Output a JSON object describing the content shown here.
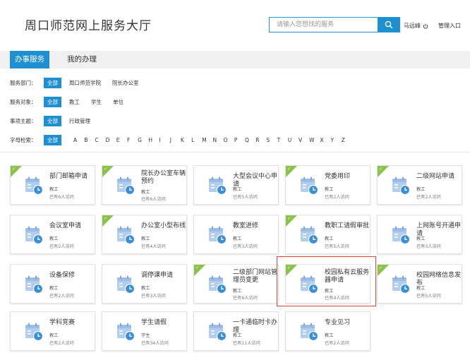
{
  "header": {
    "title": "周口师范网上服务大厅",
    "search_placeholder": "请输入您想找的服务",
    "user_name": "马远峰",
    "admin_label": "管理入口"
  },
  "nav": {
    "tabs": [
      {
        "label": "办事服务",
        "active": true
      },
      {
        "label": "我的办理",
        "active": false
      }
    ]
  },
  "filters": {
    "department": {
      "label": "服务部门：",
      "all": "全部",
      "options": [
        "周口师范学院",
        "院长办公室"
      ]
    },
    "audience": {
      "label": "服务对象：",
      "all": "全部",
      "options": [
        "教工",
        "学生",
        "单位"
      ]
    },
    "topic": {
      "label": "事项主题：",
      "all": "全部",
      "options": [
        "行政管理"
      ]
    },
    "letter": {
      "label": "字母检索：",
      "all": "全部",
      "letters": [
        "A",
        "B",
        "C",
        "D",
        "E",
        "F",
        "G",
        "H",
        "I",
        "J",
        "K",
        "L",
        "M",
        "N",
        "O",
        "P",
        "Q",
        "R",
        "S",
        "T",
        "U",
        "V",
        "W",
        "X",
        "Y",
        "Z"
      ]
    }
  },
  "services": [
    {
      "title": "部门邮箱申请",
      "audience": "教工",
      "visits": "已有6人访问",
      "badge": true
    },
    {
      "title": "院长办公室车辆预约",
      "audience": "教工",
      "visits": "已有6人访问",
      "badge": true
    },
    {
      "title": "大型会议中心申请",
      "audience": "教工",
      "visits": "已有5人访问",
      "badge": false
    },
    {
      "title": "党委用印",
      "audience": "教工",
      "visits": "已有2人访问",
      "badge": true
    },
    {
      "title": "二级网站申请",
      "audience": "教工",
      "visits": "已有2人访问",
      "badge": true
    },
    {
      "title": "会议室申请",
      "audience": "教工",
      "visits": "已有2人访问",
      "badge": false
    },
    {
      "title": "办公室小型布线",
      "audience": "教工",
      "visits": "已有4人访问",
      "badge": true
    },
    {
      "title": "教室进修",
      "audience": "教工",
      "visits": "已有3人访问",
      "badge": false
    },
    {
      "title": "教职工请假审批",
      "audience": "教工",
      "visits": "已有5人访问",
      "badge": true
    },
    {
      "title": "上网账号开通申请",
      "audience": "教工",
      "visits": "已有3人访问",
      "badge": false
    },
    {
      "title": "设备保修",
      "audience": "教工",
      "visits": "已有2人访问",
      "badge": false
    },
    {
      "title": "调停课申请",
      "audience": "教工",
      "visits": "已有3人访问",
      "badge": false
    },
    {
      "title": "二级部门网站管理员变更",
      "audience": "教工",
      "visits": "已有6人访问",
      "badge": true
    },
    {
      "title": "校园私有云服务器申请",
      "audience": "教工",
      "visits": "已有4人访问",
      "badge": true
    },
    {
      "title": "校园网络信息发布",
      "audience": "教工",
      "visits": "已有5人访问",
      "badge": true
    },
    {
      "title": "学科竞赛",
      "audience": "教工",
      "visits": "已有2人访问",
      "badge": false
    },
    {
      "title": "学生请假",
      "audience": "学生",
      "visits": "已有34人访问",
      "badge": false
    },
    {
      "title": "一卡通临时卡办理",
      "audience": "教工",
      "visits": "已有11人访问",
      "badge": false
    },
    {
      "title": "专业见习",
      "audience": "教工",
      "visits": "已有2人访问",
      "badge": false
    }
  ],
  "colors": {
    "accent": "#1e8fd0",
    "badge": "#8bc34a",
    "highlight": "#d9413a",
    "icon": "#b3cdee"
  }
}
